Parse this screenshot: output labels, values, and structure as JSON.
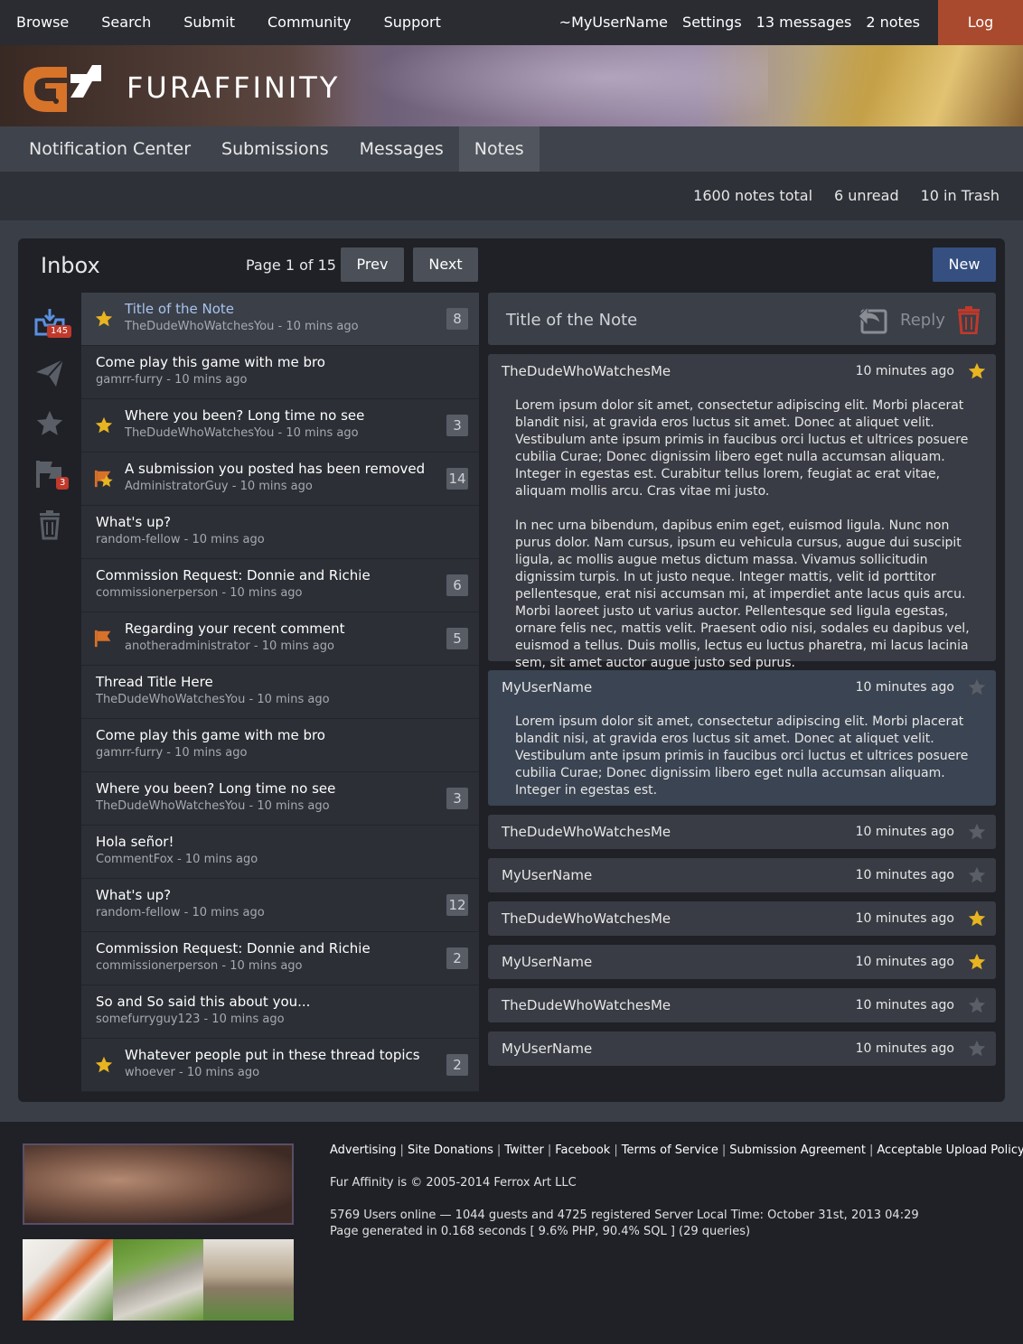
{
  "topnav": {
    "left": [
      "Browse",
      "Search",
      "Submit",
      "Community",
      "Support"
    ],
    "username": "~MyUserName",
    "settings": "Settings",
    "messages": "13 messages",
    "notes": "2 notes",
    "logout": "Log Out"
  },
  "brand": {
    "name": "FURAFFINITY"
  },
  "tabs": [
    "Notification Center",
    "Submissions",
    "Messages",
    "Notes"
  ],
  "stats": {
    "total": "1600 notes total",
    "unread": "6 unread",
    "trash": "10 in Trash"
  },
  "inbox": {
    "title": "Inbox",
    "page": "Page 1 of 15",
    "prev": "Prev",
    "next": "Next",
    "new": "New",
    "inbox_count": "145",
    "flag_count": "3"
  },
  "notes": [
    {
      "title": "Title of the Note",
      "meta": "TheDudeWhoWatchesYou - 10 mins ago",
      "count": "8",
      "mark": "star"
    },
    {
      "title": "Come play this game with me bro",
      "meta": "gamrr-furry - 10 mins ago",
      "count": "",
      "mark": ""
    },
    {
      "title": "Where you been? Long time no see",
      "meta": "TheDudeWhoWatchesYou - 10 mins ago",
      "count": "3",
      "mark": "star"
    },
    {
      "title": "A submission you posted has been removed",
      "meta": "AdministratorGuy - 10 mins ago",
      "count": "14",
      "mark": "flagstar"
    },
    {
      "title": "What's up?",
      "meta": "random-fellow - 10 mins ago",
      "count": "",
      "mark": ""
    },
    {
      "title": "Commission Request: Donnie and Richie",
      "meta": "commissionerperson - 10 mins ago",
      "count": "6",
      "mark": ""
    },
    {
      "title": "Regarding your recent comment",
      "meta": "anotheradministrator - 10 mins ago",
      "count": "5",
      "mark": "flag"
    },
    {
      "title": "Thread Title Here",
      "meta": "TheDudeWhoWatchesYou - 10 mins ago",
      "count": "",
      "mark": ""
    },
    {
      "title": "Come play this game with me bro",
      "meta": "gamrr-furry - 10 mins ago",
      "count": "",
      "mark": ""
    },
    {
      "title": "Where you been? Long time no see",
      "meta": "TheDudeWhoWatchesYou - 10 mins ago",
      "count": "3",
      "mark": ""
    },
    {
      "title": "Hola señor!",
      "meta": "CommentFox - 10 mins ago",
      "count": "",
      "mark": ""
    },
    {
      "title": "What's up?",
      "meta": "random-fellow - 10 mins ago",
      "count": "12",
      "mark": ""
    },
    {
      "title": "Commission Request: Donnie and Richie",
      "meta": "commissionerperson - 10 mins ago",
      "count": "2",
      "mark": ""
    },
    {
      "title": "So and So said this about you...",
      "meta": "somefurryguy123 - 10 mins ago",
      "count": "",
      "mark": ""
    },
    {
      "title": "Whatever people put in these thread topics",
      "meta": "whoever - 10 mins ago",
      "count": "2",
      "mark": "star"
    }
  ],
  "conversation": {
    "title": "Title of the Note",
    "reply": "Reply",
    "messages": [
      {
        "author": "TheDudeWhoWatchesMe",
        "time": "10 minutes ago",
        "starred": true,
        "expanded": true,
        "mine": false,
        "paragraphs": [
          "Lorem ipsum dolor sit amet, consectetur adipiscing elit. Morbi placerat blandit nisi, at gravida eros luctus sit amet. Donec at aliquet velit. Vestibulum ante ipsum primis in faucibus orci luctus et ultrices posuere cubilia Curae; Donec dignissim libero eget nulla accumsan aliquam. Integer in egestas est. Curabitur tellus lorem, feugiat ac erat vitae, aliquam mollis arcu. Cras vitae mi justo.",
          "In nec urna bibendum, dapibus enim eget, euismod ligula. Nunc non purus dolor. Nam cursus, ipsum eu vehicula cursus, augue dui suscipit ligula, ac mollis augue metus dictum massa. Vivamus sollicitudin dignissim turpis. In ut justo neque. Integer mattis, velit id porttitor pellentesque, erat nisi accumsan mi, at imperdiet ante lacus quis arcu. Morbi laoreet justo ut varius auctor. Pellentesque sed ligula egestas, ornare felis nec, mattis velit. Praesent odio nisi, sodales eu dapibus vel, euismod a tellus. Duis mollis, lectus eu luctus pharetra, mi lacus lacinia sem, sit amet auctor augue justo sed purus."
        ]
      },
      {
        "author": "MyUserName",
        "time": "10 minutes ago",
        "starred": false,
        "expanded": true,
        "mine": true,
        "paragraphs": [
          "Lorem ipsum dolor sit amet, consectetur adipiscing elit. Morbi placerat blandit nisi, at gravida eros luctus sit amet. Donec at aliquet velit. Vestibulum ante ipsum primis in faucibus orci luctus et ultrices posuere cubilia Curae; Donec dignissim libero eget nulla accumsan aliquam. Integer in egestas est."
        ]
      },
      {
        "author": "TheDudeWhoWatchesMe",
        "time": "10 minutes ago",
        "starred": false,
        "expanded": false
      },
      {
        "author": "MyUserName",
        "time": "10 minutes ago",
        "starred": false,
        "expanded": false
      },
      {
        "author": "TheDudeWhoWatchesMe",
        "time": "10 minutes ago",
        "starred": true,
        "expanded": false
      },
      {
        "author": "MyUserName",
        "time": "10 minutes ago",
        "starred": true,
        "expanded": false
      },
      {
        "author": "TheDudeWhoWatchesMe",
        "time": "10 minutes ago",
        "starred": false,
        "expanded": false
      },
      {
        "author": "MyUserName",
        "time": "10 minutes ago",
        "starred": false,
        "expanded": false
      }
    ]
  },
  "footer": {
    "links": [
      "Advertising",
      "Site Donations",
      "Twitter",
      "Facebook",
      "Terms of Service",
      "Submission Agreement",
      "Acceptable Upload Policy"
    ],
    "copyright": "Fur Affinity is © 2005-2014 Ferrox Art LLC",
    "online": "5769 Users online — 1044 guests and 4725 registered Server Local Time: October 31st, 2013 04:29",
    "generated": "Page generated in 0.168 seconds [ 9.6% PHP, 90.4% SQL ] (29 queries)"
  },
  "colors": {
    "star_active": "#e8b420",
    "star_inactive": "#5a5e66",
    "flag": "#d8712a",
    "accent_blue": "#355080",
    "logout": "#a94a2e"
  }
}
